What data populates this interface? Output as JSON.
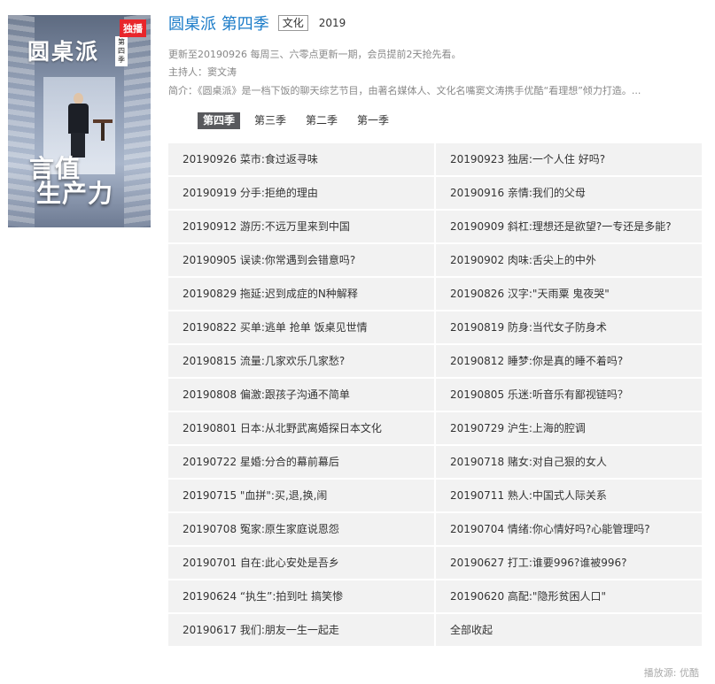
{
  "poster": {
    "exclusive_badge": "独播",
    "title": "圆桌派",
    "season_tag": "第四季",
    "slogan_line1": "言值",
    "slogan_line2": "生产力",
    "slogan_small": "就是"
  },
  "show": {
    "title": "圆桌派 第四季",
    "genre": "文化",
    "year": "2019"
  },
  "meta": {
    "update_info": "更新至20190926 每周三、六零点更新一期，会员提前2天抢先看。",
    "host_line": "主持人：窦文涛",
    "description": "简介：《圆桌派》是一档下饭的聊天综艺节目，由著名媒体人、文化名嘴窦文涛携手优酷“看理想”倾力打造。..."
  },
  "tabs": [
    {
      "label": "第四季",
      "active": true
    },
    {
      "label": "第三季",
      "active": false
    },
    {
      "label": "第二季",
      "active": false
    },
    {
      "label": "第一季",
      "active": false
    }
  ],
  "episodes": [
    "20190926 菜市:食过返寻味",
    "20190923 独居:一个人住 好吗?",
    "20190919 分手:拒绝的理由",
    "20190916 亲情:我们的父母",
    "20190912 游历:不远万里来到中国",
    "20190909 斜杠:理想还是欲望?一专还是多能?",
    "20190905 误读:你常遇到会错意吗?",
    "20190902 肉味:舌尖上的中外",
    "20190829 拖延:迟到成症的N种解释",
    "20190826 汉字:\"天雨粟 鬼夜哭\"",
    "20190822 买单:逃单 抢单 饭桌见世情",
    "20190819 防身:当代女子防身术",
    "20190815 流量:几家欢乐几家愁?",
    "20190812 睡梦:你是真的睡不着吗?",
    "20190808 偏激:跟孩子沟通不简单",
    "20190805 乐迷:听音乐有鄙视链吗？",
    "20190801 日本:从北野武离婚探日本文化",
    "20190729 沪生:上海的腔调",
    "20190722 星婚:分合的幕前幕后",
    "20190718 赌女:对自己狠的女人",
    "20190715 \"血拼\":买,退,换,闹",
    "20190711 熟人:中国式人际关系",
    "20190708 冤家:原生家庭说恩怨",
    "20190704 情绪:你心情好吗?心能管理吗?",
    "20190701 自在:此心安处是吾乡",
    "20190627 打工:谁要996?谁被996?",
    "20190624 “执生”:拍到吐 搞笑惨",
    "20190620 高配:\"隐形贫困人口\"",
    "20190617 我们:朋友一生一起走",
    "全部收起"
  ],
  "footer": {
    "source": "播放源: 优酷"
  }
}
